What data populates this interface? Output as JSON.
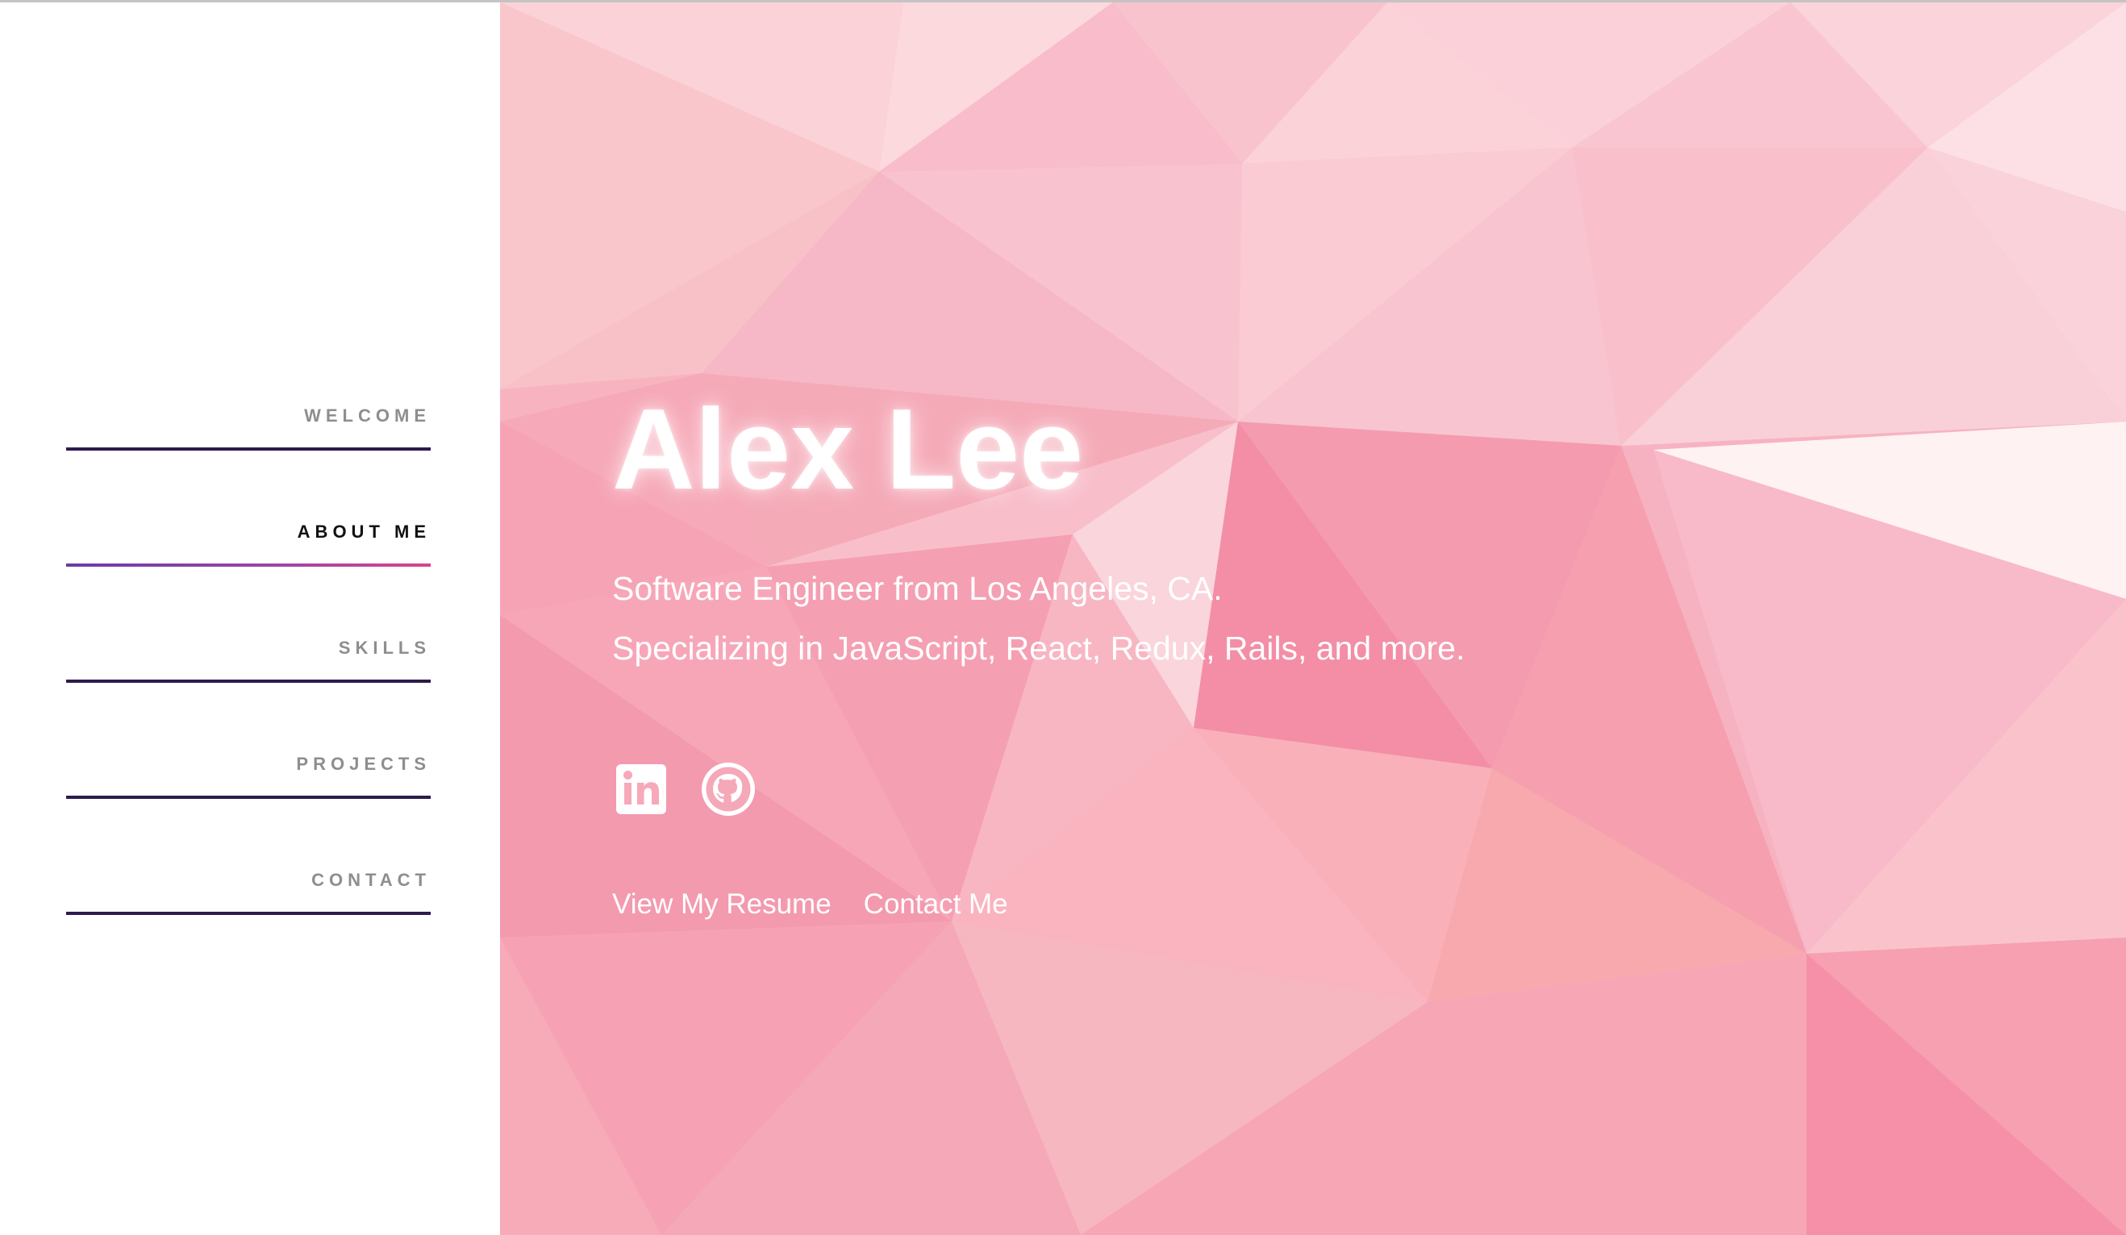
{
  "nav": {
    "items": [
      {
        "label": "WELCOME",
        "active": false
      },
      {
        "label": "ABOUT ME",
        "active": true
      },
      {
        "label": "SKILLS",
        "active": false
      },
      {
        "label": "PROJECTS",
        "active": false
      },
      {
        "label": "CONTACT",
        "active": false
      }
    ]
  },
  "hero": {
    "name": "Alex Lee",
    "tagline_line1": "Software Engineer from Los Angeles, CA.",
    "tagline_line2": "Specializing in JavaScript, React, Redux, Rails, and more.",
    "social": [
      {
        "icon": "linkedin-icon"
      },
      {
        "icon": "github-icon"
      }
    ],
    "links": {
      "resume": "View My Resume",
      "contact": "Contact Me"
    }
  },
  "colors": {
    "nav_active_text": "#111111",
    "nav_inactive_text": "#8e8e8e",
    "nav_line": "#2d1b4e",
    "nav_line_active_gradient": [
      "#6a3aa8",
      "#d9438c"
    ],
    "hero_background": "#f7b3c1",
    "hero_text": "#ffffff"
  }
}
